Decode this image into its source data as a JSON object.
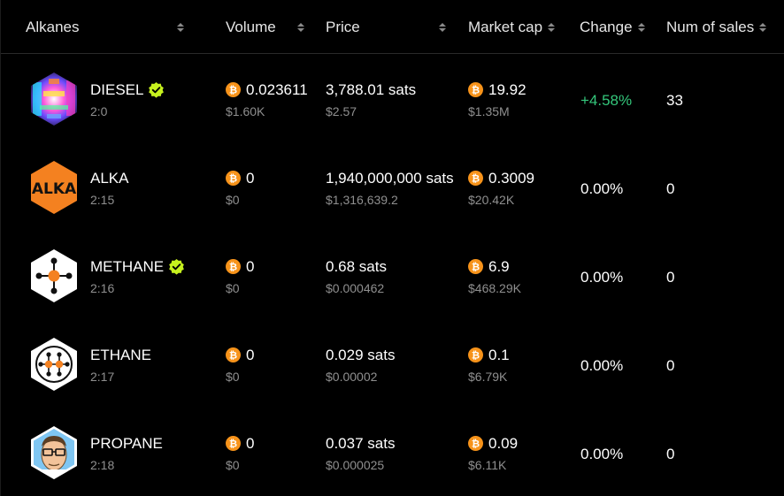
{
  "columns": [
    {
      "label": "Alkanes"
    },
    {
      "label": "Volume"
    },
    {
      "label": "Price"
    },
    {
      "label": "Market cap"
    },
    {
      "label": "Change"
    },
    {
      "label": "Num of sales"
    }
  ],
  "rows": [
    {
      "name": "DIESEL",
      "id": "2:0",
      "verified": true,
      "volume_btc": "0.023611",
      "volume_usd": "$1.60K",
      "price_sats": "3,788.01 sats",
      "price_usd": "$2.57",
      "mcap_btc": "19.92",
      "mcap_usd": "$1.35M",
      "change": "+4.58%",
      "sales": "33"
    },
    {
      "name": "ALKA",
      "id": "2:15",
      "verified": false,
      "volume_btc": "0",
      "volume_usd": "$0",
      "price_sats": "1,940,000,000 sats",
      "price_usd": "$1,316,639.2",
      "mcap_btc": "0.3009",
      "mcap_usd": "$20.42K",
      "change": "0.00%",
      "sales": "0"
    },
    {
      "name": "METHANE",
      "id": "2:16",
      "verified": true,
      "volume_btc": "0",
      "volume_usd": "$0",
      "price_sats": "0.68 sats",
      "price_usd": "$0.000462",
      "mcap_btc": "6.9",
      "mcap_usd": "$468.29K",
      "change": "0.00%",
      "sales": "0"
    },
    {
      "name": "ETHANE",
      "id": "2:17",
      "verified": false,
      "volume_btc": "0",
      "volume_usd": "$0",
      "price_sats": "0.029 sats",
      "price_usd": "$0.00002",
      "mcap_btc": "0.1",
      "mcap_usd": "$6.79K",
      "change": "0.00%",
      "sales": "0"
    },
    {
      "name": "PROPANE",
      "id": "2:18",
      "verified": false,
      "volume_btc": "0",
      "volume_usd": "$0",
      "price_sats": "0.037 sats",
      "price_usd": "$0.000025",
      "mcap_btc": "0.09",
      "mcap_usd": "$6.11K",
      "change": "0.00%",
      "sales": "0"
    }
  ],
  "logos": {
    "alka_text": "ALKA"
  },
  "icons": {
    "coin": "bitcoin-icon",
    "verified": "verified-check-icon",
    "sort": "sort-arrows-icon"
  },
  "colors": {
    "background": "#000000",
    "positive": "#34c77b",
    "bitcoin": "#f7931a",
    "verified": "#c6f11e",
    "alka_orange": "#f48120",
    "muted": "#8f8f8f"
  }
}
